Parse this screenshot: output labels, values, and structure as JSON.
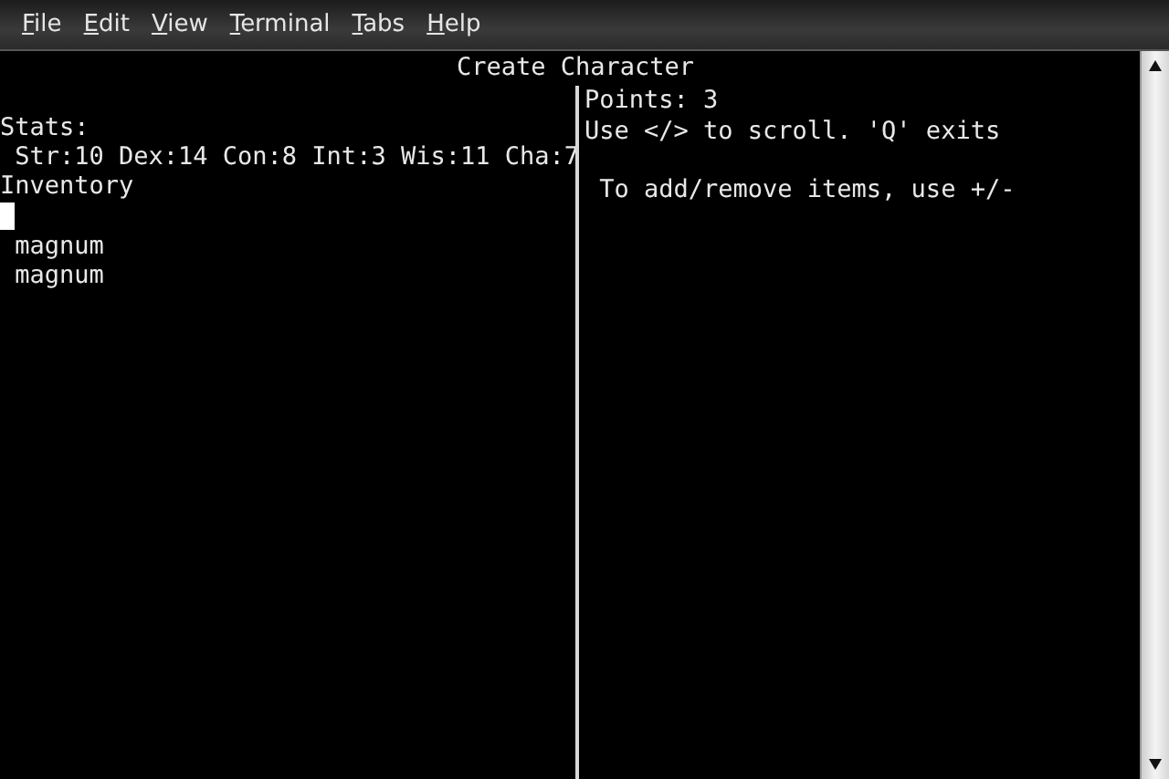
{
  "menu": [
    "File",
    "Edit",
    "View",
    "Terminal",
    "Tabs",
    "Help"
  ],
  "terminal": {
    "title": "Create Character",
    "left_lines": [
      {
        "kind": "blank"
      },
      {
        "kind": "text",
        "text": "Stats:"
      },
      {
        "kind": "text",
        "text": " Str:10 Dex:14 Con:8 Int:3 Wis:11 Cha:7"
      },
      {
        "kind": "text",
        "text": "Inventory"
      },
      {
        "kind": "cursor"
      },
      {
        "kind": "text",
        "text": " magnum"
      },
      {
        "kind": "text",
        "text": " magnum"
      }
    ],
    "right_lines": [
      {
        "kind": "text",
        "text": "Points: 3"
      },
      {
        "kind": "text",
        "text": "Use </> to scroll. 'Q' exits"
      },
      {
        "kind": "blank"
      },
      {
        "kind": "text",
        "text": " To add/remove items, use +/-"
      }
    ]
  }
}
